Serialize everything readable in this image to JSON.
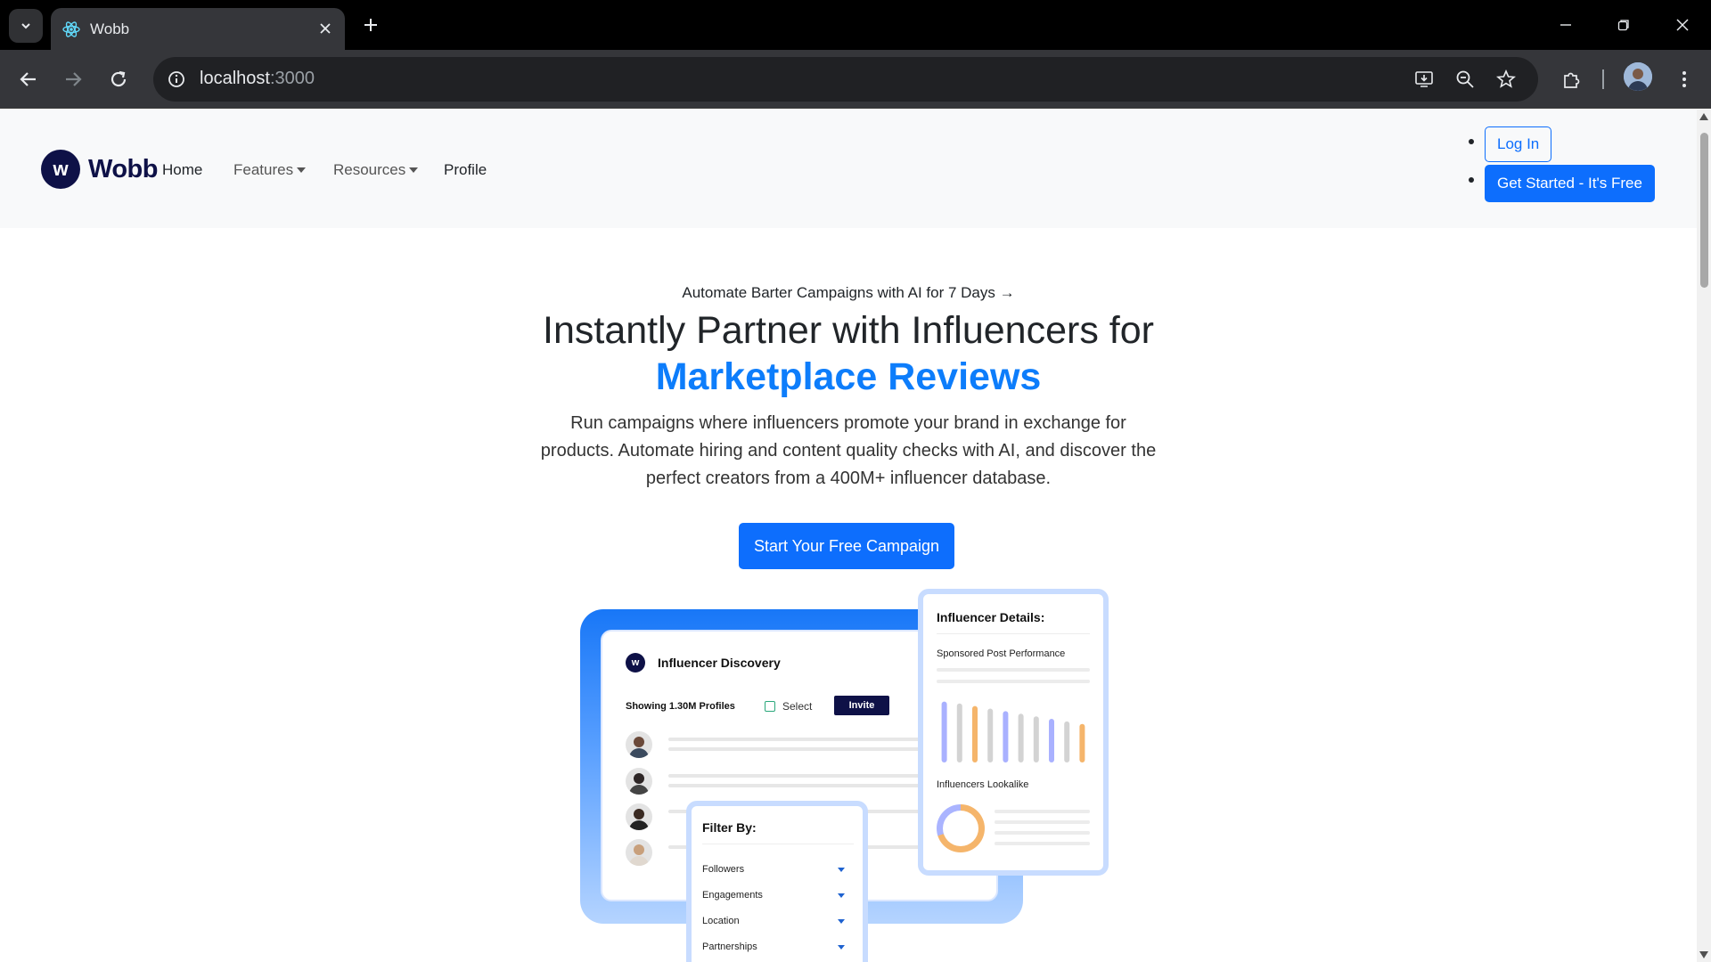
{
  "browser": {
    "tab": {
      "title": "Wobb",
      "favicon": "react-atom-icon"
    },
    "url_host": "localhost",
    "url_port": ":3000"
  },
  "nav": {
    "brand": "Wobb",
    "brand_logo_letter": "w",
    "links": [
      "Home",
      "Features",
      "Resources",
      "Profile"
    ],
    "login": "Log In",
    "get_started": "Get Started - It's Free"
  },
  "hero": {
    "subtitle": "Automate Barter Campaigns with AI for 7 Days →",
    "title_line1": "Instantly Partner with Influencers for",
    "title_accent": "Marketplace Reviews",
    "description": "Run campaigns where influencers promote your brand in exchange for products. Automate hiring and content quality checks with AI, and discover the perfect creators from a 400M+ influencer database.",
    "cta": "Start Your Free Campaign"
  },
  "illustration": {
    "discovery": {
      "title": "Influencer Discovery",
      "showing": "Showing 1.30M Profiles",
      "select": "Select",
      "invite": "Invite"
    },
    "details": {
      "title": "Influencer Details:",
      "sponsored": "Sponsored Post Performance",
      "lookalike": "Influencers Lookalike",
      "bars": [
        {
          "value": 0.95,
          "color": "#a9b1ff"
        },
        {
          "value": 0.92,
          "color": "#d3d3d3"
        },
        {
          "value": 0.88,
          "color": "#f5b56b"
        },
        {
          "value": 0.84,
          "color": "#d3d3d3"
        },
        {
          "value": 0.8,
          "color": "#a9b1ff"
        },
        {
          "value": 0.76,
          "color": "#d3d3d3"
        },
        {
          "value": 0.72,
          "color": "#d3d3d3"
        },
        {
          "value": 0.68,
          "color": "#a9b1ff"
        },
        {
          "value": 0.64,
          "color": "#d3d3d3"
        },
        {
          "value": 0.6,
          "color": "#f5b56b"
        }
      ]
    },
    "filter": {
      "title": "Filter By:",
      "items": [
        "Followers",
        "Engagements",
        "Location",
        "Partnerships"
      ]
    }
  },
  "colors": {
    "primary": "#0d6efd",
    "accent": "#0d7dfb",
    "brand_dark": "#0e1147"
  }
}
